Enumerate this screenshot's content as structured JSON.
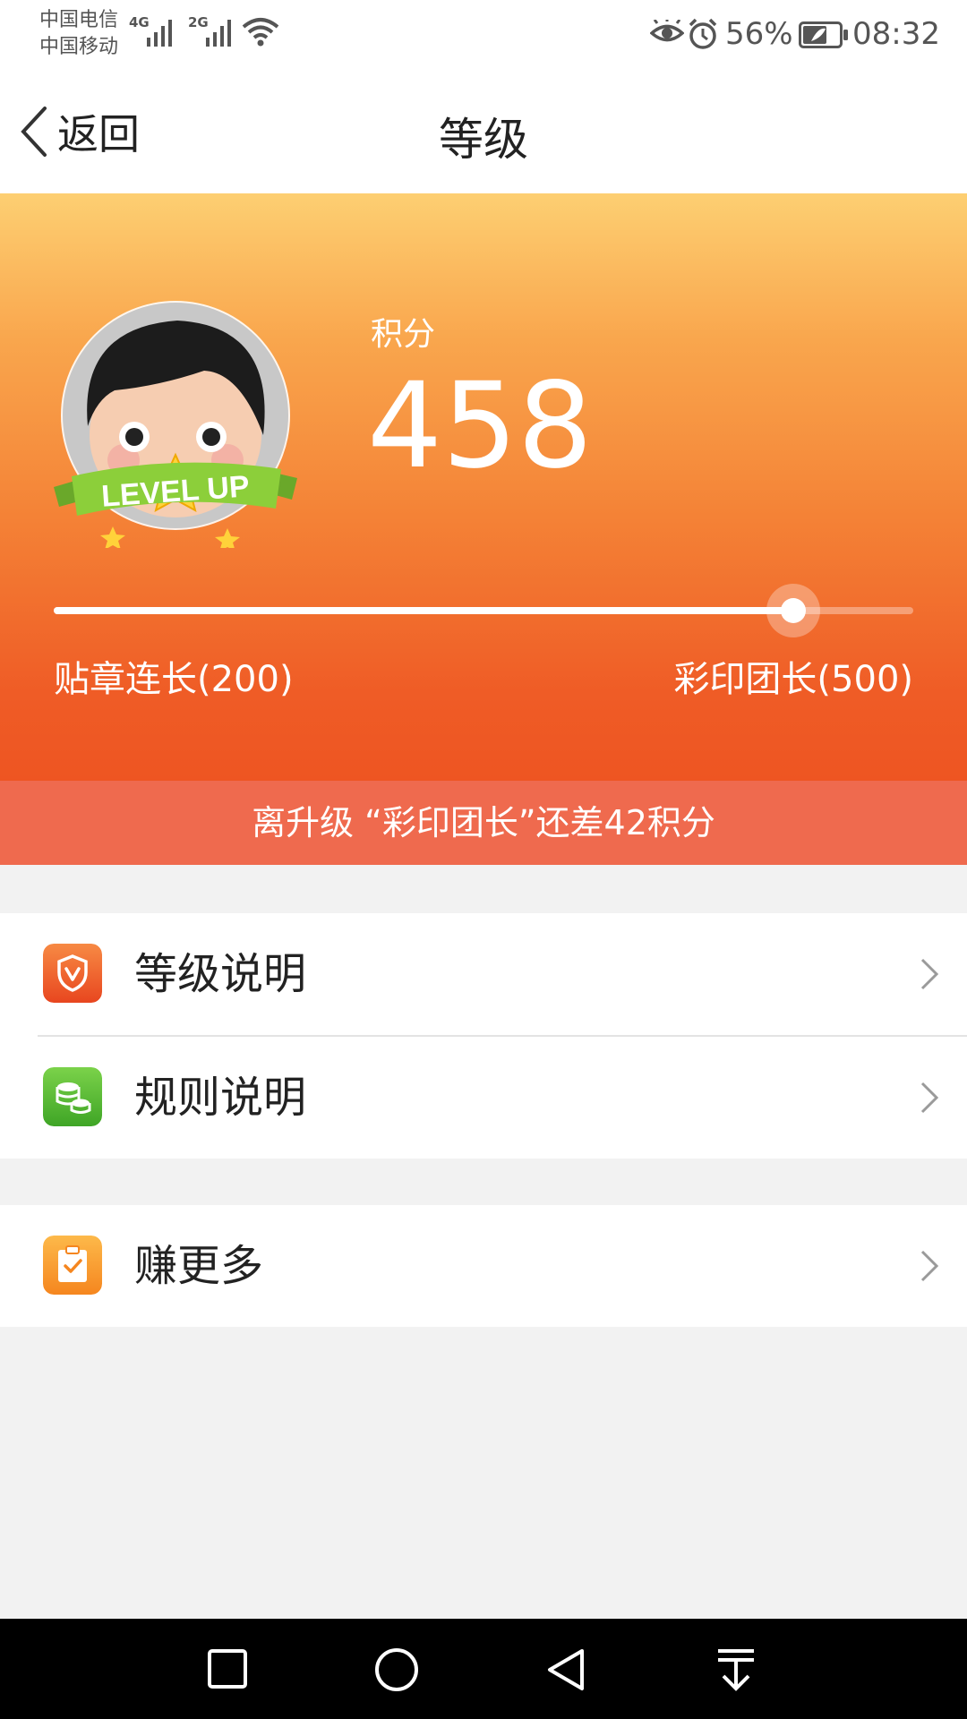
{
  "status_bar": {
    "carrier_1": "中国电信",
    "carrier_2": "中国移动",
    "network_1": "4G",
    "network_2": "2G",
    "battery_percent": "56%",
    "time": "08:32"
  },
  "navbar": {
    "back_label": "返回",
    "title": "等级"
  },
  "hero": {
    "points_label": "积分",
    "points_value": "458",
    "avatar_badge_text": "LEVEL UP",
    "current_level": "贴章连长(200)",
    "next_level": "彩印团长(500)",
    "progress_fraction": 0.86,
    "upgrade_hint": "离升级 “彩印团长”还差42积分"
  },
  "menu": {
    "items": [
      {
        "label": "等级说明",
        "icon": "shield-v-icon",
        "color": "#f0602e"
      },
      {
        "label": "规则说明",
        "icon": "coin-stack-icon",
        "color": "#5fbf3a"
      },
      {
        "label": "赚更多",
        "icon": "clipboard-check-icon",
        "color": "#f99a2a"
      }
    ]
  },
  "colors": {
    "hero_top": "#fdcf72",
    "hero_bottom": "#ee5522",
    "banner": "#ef6a4e",
    "background": "#f2f2f2"
  }
}
